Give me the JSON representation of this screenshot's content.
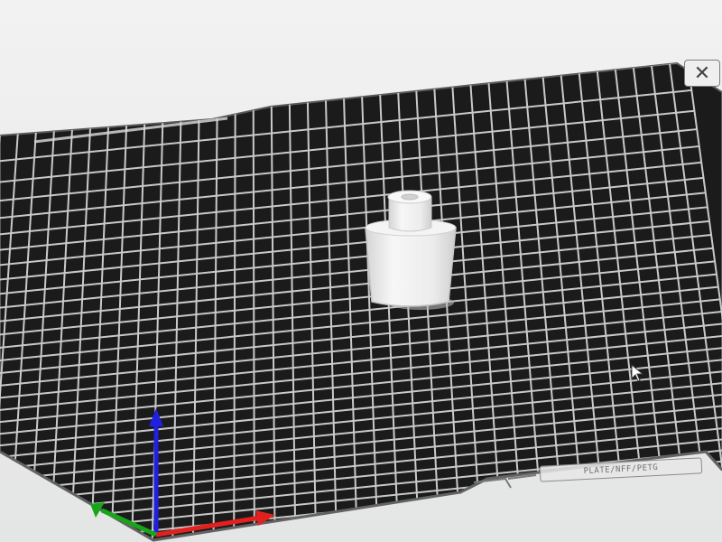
{
  "viewport": {
    "corner_button_glyph": "✕",
    "plate_label": "PLATE/NFF/PETG"
  },
  "axes": {
    "x_color": "#e32020",
    "y_color": "#18a51c",
    "z_color": "#2020e0"
  },
  "bed": {
    "surface_color": "#1b1b1b",
    "grid_color": "#d8d8d8"
  },
  "model": {
    "color": "#ececec"
  }
}
